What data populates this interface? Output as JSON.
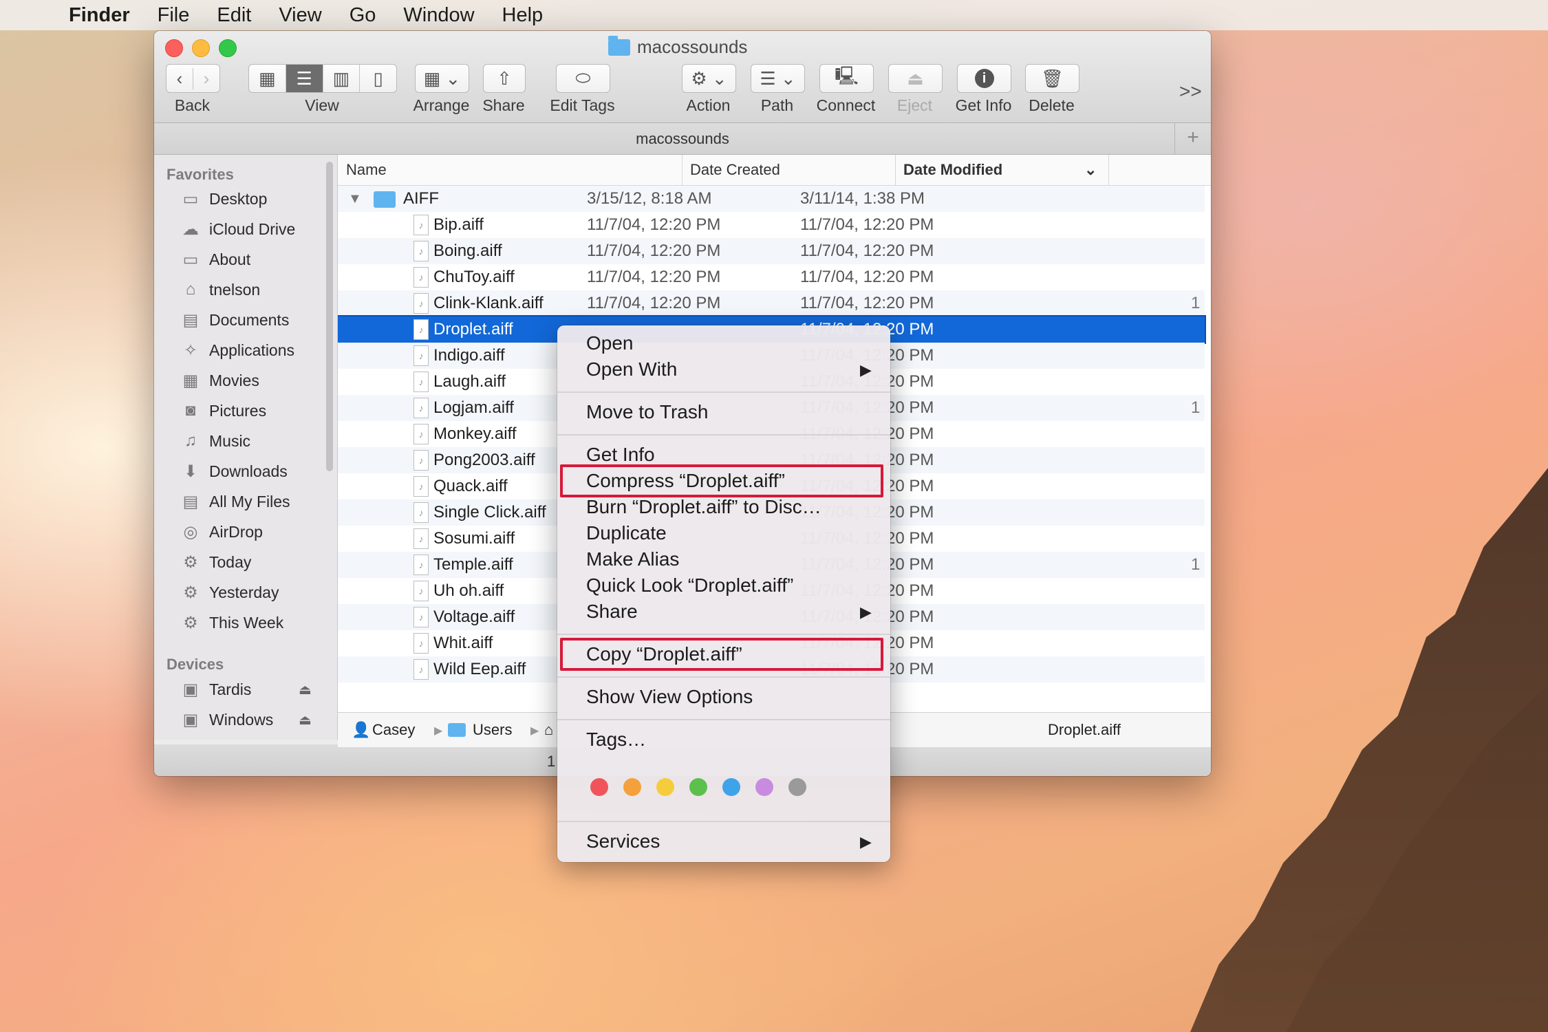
{
  "menubar": {
    "app": "Finder",
    "items": [
      "File",
      "Edit",
      "View",
      "Go",
      "Window",
      "Help"
    ]
  },
  "window": {
    "title": "macossounds",
    "path_title": "macossounds",
    "toolbar": {
      "back": "Back",
      "view": "View",
      "arrange": "Arrange",
      "share": "Share",
      "edit_tags": "Edit Tags",
      "action": "Action",
      "path": "Path",
      "connect": "Connect",
      "eject": "Eject",
      "get_info": "Get Info",
      "delete": "Delete",
      "more": ">>"
    }
  },
  "sidebar": {
    "favorites_header": "Favorites",
    "favorites": [
      {
        "label": "Desktop",
        "icon": "desktop-icon"
      },
      {
        "label": "iCloud Drive",
        "icon": "cloud-icon"
      },
      {
        "label": "About",
        "icon": "folder-icon"
      },
      {
        "label": "tnelson",
        "icon": "home-icon"
      },
      {
        "label": "Documents",
        "icon": "documents-icon"
      },
      {
        "label": "Applications",
        "icon": "applications-icon"
      },
      {
        "label": "Movies",
        "icon": "film-icon"
      },
      {
        "label": "Pictures",
        "icon": "camera-icon"
      },
      {
        "label": "Music",
        "icon": "music-note-icon"
      },
      {
        "label": "Downloads",
        "icon": "download-icon"
      },
      {
        "label": "All My Files",
        "icon": "all-files-icon"
      },
      {
        "label": "AirDrop",
        "icon": "airdrop-icon"
      },
      {
        "label": "Today",
        "icon": "gear-icon"
      },
      {
        "label": "Yesterday",
        "icon": "gear-icon"
      },
      {
        "label": "This Week",
        "icon": "gear-icon"
      }
    ],
    "devices_header": "Devices",
    "devices": [
      {
        "label": "Tardis",
        "icon": "disk-icon"
      },
      {
        "label": "Windows",
        "icon": "disk-icon"
      }
    ]
  },
  "list": {
    "columns": [
      "Name",
      "Date Created",
      "Date Modified"
    ],
    "folder": {
      "name": "AIFF",
      "created": "3/15/12, 8:18 AM",
      "modified": "3/11/14, 1:38 PM"
    },
    "files": [
      {
        "name": "Bip.aiff",
        "created": "11/7/04, 12:20 PM",
        "modified": "11/7/04, 12:20 PM",
        "extra": ""
      },
      {
        "name": "Boing.aiff",
        "created": "11/7/04, 12:20 PM",
        "modified": "11/7/04, 12:20 PM",
        "extra": ""
      },
      {
        "name": "ChuToy.aiff",
        "created": "11/7/04, 12:20 PM",
        "modified": "11/7/04, 12:20 PM",
        "extra": ""
      },
      {
        "name": "Clink-Klank.aiff",
        "created": "11/7/04, 12:20 PM",
        "modified": "11/7/04, 12:20 PM",
        "extra": "1"
      },
      {
        "name": "Droplet.aiff",
        "created": "",
        "modified": "11/7/04, 12:20 PM",
        "extra": ""
      },
      {
        "name": "Indigo.aiff",
        "created": "",
        "modified": "11/7/04, 12:20 PM",
        "extra": ""
      },
      {
        "name": "Laugh.aiff",
        "created": "",
        "modified": "11/7/04, 12:20 PM",
        "extra": ""
      },
      {
        "name": "Logjam.aiff",
        "created": "",
        "modified": "11/7/04, 12:20 PM",
        "extra": "1"
      },
      {
        "name": "Monkey.aiff",
        "created": "",
        "modified": "11/7/04, 12:20 PM",
        "extra": ""
      },
      {
        "name": "Pong2003.aiff",
        "created": "",
        "modified": "11/7/04, 12:20 PM",
        "extra": ""
      },
      {
        "name": "Quack.aiff",
        "created": "",
        "modified": "11/7/04, 12:20 PM",
        "extra": ""
      },
      {
        "name": "Single Click.aiff",
        "created": "",
        "modified": "11/7/04, 12:20 PM",
        "extra": ""
      },
      {
        "name": "Sosumi.aiff",
        "created": "",
        "modified": "11/7/04, 12:20 PM",
        "extra": ""
      },
      {
        "name": "Temple.aiff",
        "created": "",
        "modified": "11/7/04, 12:20 PM",
        "extra": "1"
      },
      {
        "name": "Uh oh.aiff",
        "created": "",
        "modified": "11/7/04, 12:20 PM",
        "extra": ""
      },
      {
        "name": "Voltage.aiff",
        "created": "",
        "modified": "11/7/04, 12:20 PM",
        "extra": ""
      },
      {
        "name": "Whit.aiff",
        "created": "",
        "modified": "11/7/04, 12:20 PM",
        "extra": ""
      },
      {
        "name": "Wild Eep.aiff",
        "created": "",
        "modified": "11/7/04, 12:20 PM",
        "extra": ""
      }
    ],
    "selected_index": 4
  },
  "pathcrumb": {
    "items": [
      "Casey",
      "Users",
      "",
      "Droplet.aiff"
    ],
    "status_partial": "1"
  },
  "context_menu": {
    "open": "Open",
    "open_with": "Open With",
    "move_to_trash": "Move to Trash",
    "get_info": "Get Info",
    "compress": "Compress “Droplet.aiff”",
    "burn": "Burn “Droplet.aiff” to Disc…",
    "duplicate": "Duplicate",
    "make_alias": "Make Alias",
    "quick_look": "Quick Look “Droplet.aiff”",
    "share": "Share",
    "copy": "Copy “Droplet.aiff”",
    "show_view_options": "Show View Options",
    "tags": "Tags…",
    "services": "Services",
    "tag_colors": [
      "#f0545a",
      "#f4a13c",
      "#f5cd3c",
      "#5cc04c",
      "#3fa3ea",
      "#c98be0",
      "#9a9a9a"
    ],
    "highlight_color": "#d7193a"
  }
}
